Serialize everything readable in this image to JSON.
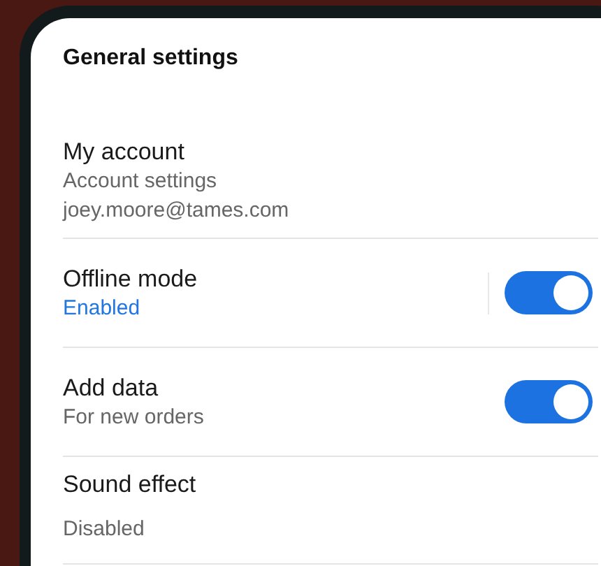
{
  "section_title": "General settings",
  "items": [
    {
      "kind": "account",
      "title": "My account",
      "lines": [
        "Account settings",
        "joey.moore@tames.com"
      ]
    },
    {
      "kind": "toggle",
      "title": "Offline mode",
      "subtitle": "Enabled",
      "accent": true,
      "split": true,
      "on": true
    },
    {
      "kind": "toggle",
      "title": "Add data",
      "subtitle": "For new orders",
      "accent": false,
      "split": false,
      "on": true
    },
    {
      "kind": "value",
      "title": "Sound effect",
      "value": "Disabled"
    }
  ]
}
